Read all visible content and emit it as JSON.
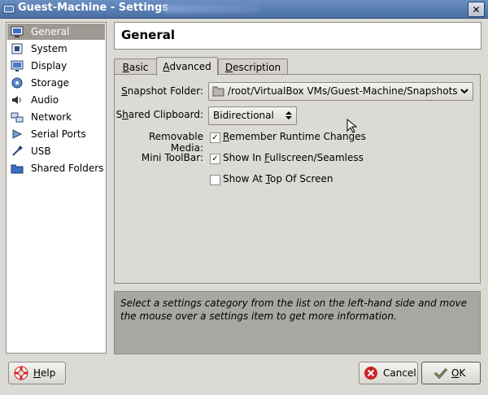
{
  "window": {
    "title": "Guest-Machine - Settings",
    "close_glyph": "✕"
  },
  "sidebar": {
    "items": [
      {
        "label": "General",
        "icon": "general-icon",
        "selected": true
      },
      {
        "label": "System",
        "icon": "system-icon"
      },
      {
        "label": "Display",
        "icon": "display-icon"
      },
      {
        "label": "Storage",
        "icon": "storage-icon"
      },
      {
        "label": "Audio",
        "icon": "audio-icon"
      },
      {
        "label": "Network",
        "icon": "network-icon"
      },
      {
        "label": "Serial Ports",
        "icon": "serial-ports-icon"
      },
      {
        "label": "USB",
        "icon": "usb-icon"
      },
      {
        "label": "Shared Folders",
        "icon": "shared-folders-icon"
      }
    ]
  },
  "header": {
    "title": "General"
  },
  "tabs": [
    {
      "label": "Basic",
      "u": "B",
      "rest": "asic"
    },
    {
      "label": "Advanced",
      "u": "A",
      "rest": "dvanced",
      "active": true
    },
    {
      "label": "Description",
      "u": "D",
      "rest": "escription"
    }
  ],
  "advanced": {
    "snapshot_label_u": "S",
    "snapshot_label_rest": "napshot Folder:",
    "snapshot_value": "/root/VirtualBox VMs/Guest-Machine/Snapshots",
    "clipboard_label_pre": "S",
    "clipboard_label_u": "h",
    "clipboard_label_rest": "ared Clipboard:",
    "clipboard_value": "Bidirectional",
    "removable_label": "Removable Media:",
    "remember_u": "R",
    "remember_rest": "emember Runtime Changes",
    "remember_checked": true,
    "minitoolbar_label": "Mini ToolBar:",
    "show_fullscreen_pre": "Show In ",
    "show_fullscreen_u": "F",
    "show_fullscreen_rest": "ullscreen/Seamless",
    "show_fullscreen_checked": true,
    "show_top_pre": "Show At ",
    "show_top_u": "T",
    "show_top_rest": "op Of Screen",
    "show_top_checked": false
  },
  "info": {
    "text": "Select a settings category from the list on the left-hand side and move the mouse over a settings item to get more information."
  },
  "buttons": {
    "help_u": "H",
    "help_rest": "elp",
    "cancel": "Cancel",
    "ok_u": "O",
    "ok_rest": "K"
  },
  "colors": {
    "titlebar": "#4a6fa5",
    "selected": "#9d9a93",
    "info_bg": "#a9a7a2",
    "cancel_red": "#cc2222"
  }
}
